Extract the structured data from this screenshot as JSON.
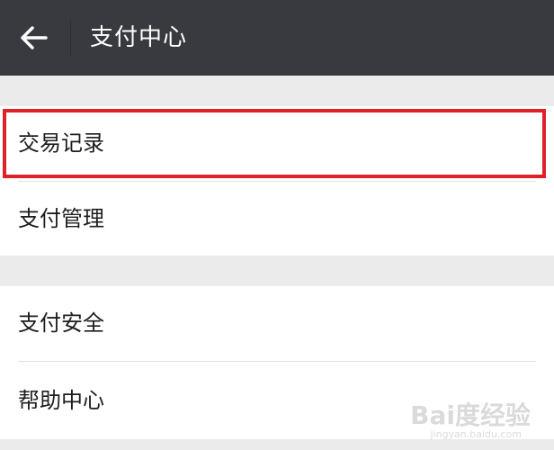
{
  "header": {
    "title": "支付中心",
    "back_icon": "arrow-left-icon"
  },
  "menu": {
    "group1": [
      {
        "label": "交易记录",
        "highlighted": true
      },
      {
        "label": "支付管理",
        "highlighted": false
      }
    ],
    "group2": [
      {
        "label": "支付安全"
      },
      {
        "label": "帮助中心"
      }
    ]
  },
  "colors": {
    "titlebar_bg": "#393a3f",
    "page_bg": "#ebebeb",
    "highlight_border": "#e0212a"
  },
  "watermark": {
    "text": "Bai度经验",
    "subtext": "jingyan.baidu.com"
  }
}
